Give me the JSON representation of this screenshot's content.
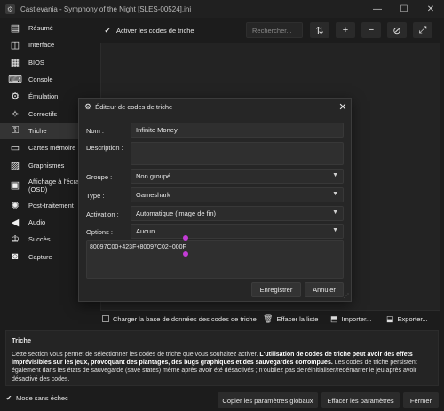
{
  "window": {
    "title": "Castlevania - Symphony of the Night [SLES-00524].ini",
    "controls": [
      "—",
      "☐",
      "✕"
    ]
  },
  "sidebar": {
    "items": [
      {
        "label": "Résumé",
        "icon": "document-list-icon",
        "glyph": "▤"
      },
      {
        "label": "Interface",
        "icon": "window-icon",
        "glyph": "◫"
      },
      {
        "label": "BIOS",
        "icon": "chip-icon",
        "glyph": "▦"
      },
      {
        "label": "Console",
        "icon": "console-icon",
        "glyph": "⌨"
      },
      {
        "label": "Émulation",
        "icon": "gear-chip-icon",
        "glyph": "⚙"
      },
      {
        "label": "Correctifs",
        "icon": "sparkle-icon",
        "glyph": "✧"
      },
      {
        "label": "Triche",
        "icon": "cheat-icon",
        "glyph": "⚿"
      },
      {
        "label": "Cartes mémoire",
        "icon": "memory-card-icon",
        "glyph": "▭"
      },
      {
        "label": "Graphismes",
        "icon": "image-icon",
        "glyph": "▨"
      },
      {
        "label": "Affichage à l'écra",
        "label2": "(OSD)",
        "icon": "display-icon",
        "glyph": "▣"
      },
      {
        "label": "Post-traitement",
        "icon": "sun-icon",
        "glyph": "✺"
      },
      {
        "label": "Audio",
        "icon": "speaker-icon",
        "glyph": "◀"
      },
      {
        "label": "Succès",
        "icon": "trophy-icon",
        "glyph": "♔"
      },
      {
        "label": "Capture",
        "icon": "camera-icon",
        "glyph": "◙"
      }
    ],
    "active_index": 6
  },
  "toolbar": {
    "enable_label": "Activer les codes de triche",
    "search_placeholder": "Rechercher...",
    "buttons": [
      "sort-icon",
      "add-icon",
      "remove-icon",
      "disable-icon"
    ]
  },
  "bottom": {
    "load_db": "Charger la base de données des codes de triche",
    "clear_list": "Effacer la liste",
    "import": "Importer...",
    "export": "Exporter..."
  },
  "help": {
    "title": "Triche",
    "text_intro": "Cette section vous permet de sélectionner les codes de triche que vous souhaitez activer. ",
    "text_bold": "L'utilisation de codes de triche peut avoir des effets imprévisibles sur les jeux, provoquant des plantages, des bugs graphiques et des sauvegardes corrompues.",
    "text_rest": " Les codes de triche persistent également dans les états de sauvegarde (save states) même après avoir été désactivés ; n'oubliez pas de réinitialiser/redémarrer le jeu après avoir désactivé des codes."
  },
  "status": {
    "safe_mode": "Mode sans échec",
    "copy_global": "Copier les paramètres globaux",
    "clear_settings": "Effacer les paramètres",
    "close": "Fermer"
  },
  "dialog": {
    "title": "Éditeur de codes de triche",
    "labels": {
      "name": "Nom :",
      "description": "Description :",
      "group": "Groupe :",
      "type": "Type :",
      "activation": "Activation :",
      "options": "Options :"
    },
    "values": {
      "name": "Infinite Money",
      "description": "",
      "group": "Non groupé",
      "type": "Gameshark",
      "activation": "Automatique (image de fin)",
      "options": "Aucun"
    },
    "code": "80097C00+423F+80097C02+000F",
    "save": "Enregistrer",
    "cancel": "Annuler"
  },
  "colors": {
    "accent_marker": "#c33cd6",
    "background": "#1c1c1c"
  }
}
